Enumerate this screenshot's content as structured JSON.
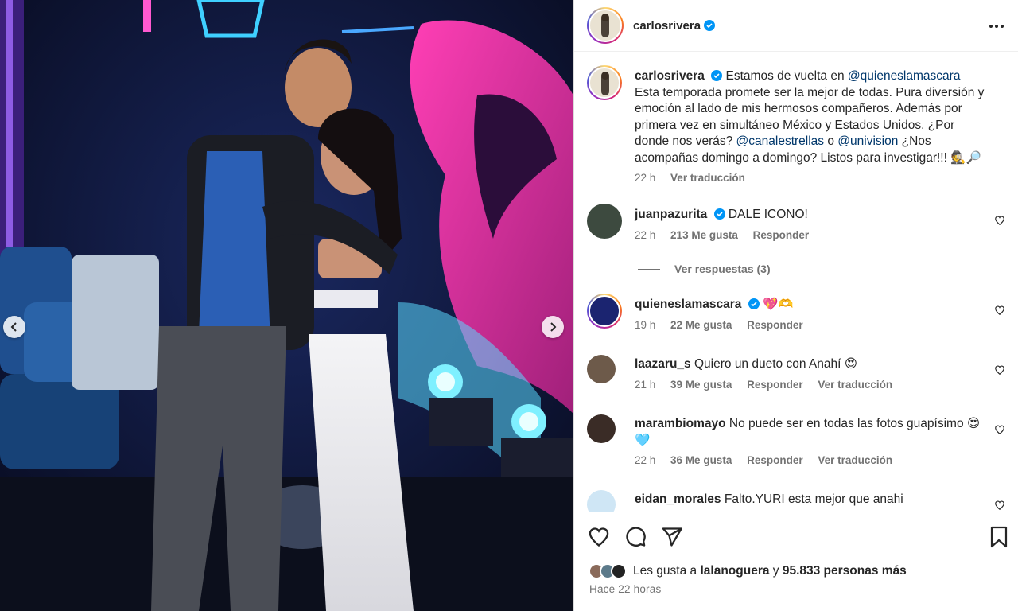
{
  "post": {
    "author": "carlosrivera",
    "caption_parts": [
      {
        "t": "Estamos de vuelta en "
      },
      {
        "t": "@quieneslamascara",
        "m": true
      },
      {
        "t": " Esta temporada promete ser la mejor de todas. Pura diversión y emoción al lado de mis hermosos compañeros. Además por primera vez en simultáneo México y Estados Unidos. ¿Por donde nos verás? "
      },
      {
        "t": "@canalestrellas",
        "m": true
      },
      {
        "t": " o "
      },
      {
        "t": "@univision",
        "m": true
      },
      {
        "t": " ¿Nos acompañas domingo a domingo? Listos para investigar!!! 🕵️🔎"
      }
    ],
    "caption_time": "22 h",
    "see_translation": "Ver traducción"
  },
  "comments": [
    {
      "user": "juanpazurita",
      "verified": true,
      "text": "DALE ICONO!",
      "time": "22 h",
      "likes": "213 Me gusta",
      "reply": "Responder",
      "translate": ""
    },
    {
      "user": "quieneslamascara",
      "verified": true,
      "text": "💖🫶",
      "time": "19 h",
      "likes": "22 Me gusta",
      "reply": "Responder",
      "translate": ""
    },
    {
      "user": "laazaru_s",
      "verified": false,
      "text": "Quiero un dueto con Anahí 😍",
      "time": "21 h",
      "likes": "39 Me gusta",
      "reply": "Responder",
      "translate": "Ver traducción"
    },
    {
      "user": "marambiomayo",
      "verified": false,
      "text": "No puede ser en todas las fotos guapísimo 😍🩵",
      "time": "22 h",
      "likes": "36 Me gusta",
      "reply": "Responder",
      "translate": "Ver traducción"
    },
    {
      "user": "eidan_morales",
      "verified": false,
      "text": "Falto.YURI esta mejor que anahi",
      "time": "",
      "likes": "",
      "reply": "",
      "translate": ""
    }
  ],
  "replies_toggle": "Ver respuestas (3)",
  "likes": {
    "prefix": "Les gusta a ",
    "user": "lalanoguera",
    "mid": " y ",
    "count": "95.833 personas más"
  },
  "timestamp": "Hace 22 horas",
  "icons": [
    "more-icon",
    "heart-icon",
    "comment-icon",
    "share-icon",
    "bookmark-icon",
    "chevron-left-icon",
    "chevron-right-icon",
    "verified-badge-icon"
  ],
  "colors": {
    "mention": "#00376b",
    "verified": "#0095f6",
    "secondary": "#737373"
  }
}
